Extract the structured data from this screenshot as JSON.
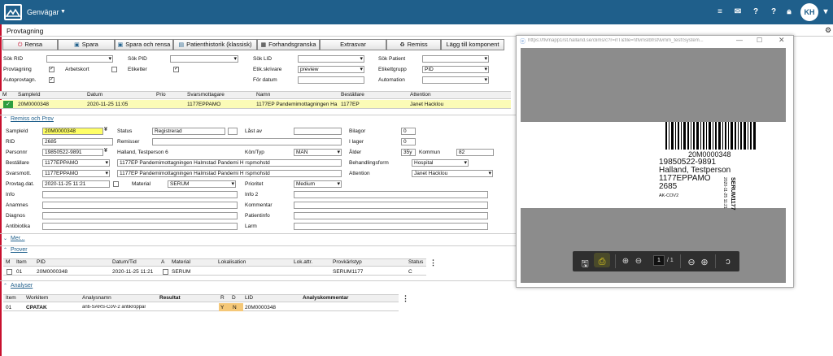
{
  "topbar": {
    "title": "Genvägar",
    "avatar": "KH",
    "icons": [
      "menu-icon",
      "mail-icon",
      "help-icon",
      "help-icon",
      "lock-icon"
    ]
  },
  "page": {
    "title": "Provtagning"
  },
  "toolbar": {
    "rensa": "Rensa",
    "spara": "Spara",
    "spara_rensa": "Spara och rensa",
    "historik": "Patienthistorik (klassisk)",
    "forhand": "Forhandsgranska",
    "extrasvar": "Extrasvar",
    "remiss": "Remiss",
    "lagg": "Lägg till komponent"
  },
  "search": {
    "sok_rid": "Sök RID",
    "sok_pid": "Sök PID",
    "sok_lid": "Sök LID",
    "sok_patient": "Sök Patient",
    "provtagning": "Provtagning",
    "arbetskort": "Arbetskort",
    "etiketter": "Etiketter",
    "etik_skrivare": "Etik.skrivare",
    "etik_skrivare_val": "preview",
    "etikettgrupp": "Etikettgrupp",
    "etikettgrupp_val": "PID",
    "autoprovtagn": "Autoprovtagn.",
    "for_datum": "För datum",
    "automation": "Automation"
  },
  "sample_table": {
    "headers": [
      "M",
      "SampleId",
      "Datum",
      "Prio",
      "Svarsmottagare",
      "Namn",
      "Beställare",
      "Attention"
    ],
    "row": [
      "",
      "20M0000348",
      "2020-11-25 11:05",
      "",
      "1177EPPAMO",
      "1177EP Pandemimottagningen Ha",
      "1177EP",
      "Janet Hacklou"
    ]
  },
  "remiss": {
    "section": "Remiss och Prov",
    "sampleid_label": "SampleId",
    "sampleid": "20M0000348",
    "status_label": "Status",
    "status": "Registrerad",
    "last_av_label": "Låst av",
    "bilagor_label": "Bilagor",
    "bilagor": "0",
    "rid_label": "RID",
    "rid": "2685",
    "remisser_label": "Remisser",
    "i_lager_label": "I lager",
    "i_lager": "0",
    "personnr_label": "Personnr",
    "personnr": "19850522-9891",
    "patient": "Halland, Testperson 6",
    "kon_label": "Kön/Typ",
    "kon": "MAN",
    "alder_label": "Ålder",
    "alder": "35y",
    "kommun_label": "Kommun",
    "kommun": "82",
    "bestallare_label": "Beställare",
    "bestallare": "1177EPPAMO",
    "bestallare_namn": "1177EP Pandemimottagningen Halmstad Pandemi H rspmohstd",
    "behandling_label": "Behandlingsform",
    "behandling": "Hospital",
    "svarsmott_label": "Svarsmott.",
    "svarsmott": "1177EPPAMO",
    "svarsmott_namn": "1177EP Pandemimottagningen Halmstad Pandemi H rspmohstd",
    "attention_label": "Attention",
    "attention": "Janet Hacklou",
    "provtag_label": "Provtag.dat.",
    "provtag": "2020-11-25 11:21",
    "material_label": "Material",
    "material": "SERUM",
    "prioritet_label": "Prioritet",
    "prioritet": "Medium",
    "info_label": "Info",
    "info2_label": "Info 2",
    "anamnes_label": "Anamnes",
    "kommentar_label": "Kommentar",
    "diagnos_label": "Diagnos",
    "patientinfo_label": "Patientinfo",
    "antibiotika_label": "Antibiotika",
    "larm_label": "Larm"
  },
  "mer": "Mer...",
  "prover": {
    "section": "Prover",
    "headers": [
      "M",
      "Item",
      "PID",
      "Datum/Tid",
      "A",
      "Material",
      "Lokalisation",
      "Lok.attr.",
      "Provkärlstyp",
      "Status"
    ],
    "row": [
      "",
      "01",
      "20M0000348",
      "2020-11-25 11:21",
      "",
      "SERUM",
      "",
      "",
      "SERUM1177",
      "C"
    ]
  },
  "analyser": {
    "section": "Analyser",
    "headers": [
      "Item",
      "Workitem",
      "Analysnamn",
      "Resultat",
      "R",
      "D",
      "LID",
      "Analyskommentar"
    ],
    "row": [
      "01",
      "CPATAK",
      "anti-SARS-CoV-2 antikroppar",
      "",
      "Y",
      "N",
      "20M0000348",
      ""
    ]
  },
  "popup": {
    "url": "https://flvmapp1rst.halland.se/clims/c?r=rrT&file=\\\\flvmslbfrst\\lvmm_test\\System...",
    "label": {
      "code": "20M0000348",
      "pnr": "19850522-9891",
      "name": "Halland, Testperson",
      "orderer": "1177EPPAMO",
      "rid": "2685",
      "analysis": "AK-COV2",
      "side_title": "SERUM1177",
      "side_date": "2020-11-25 11:21"
    },
    "page_current": "1",
    "page_total": "/ 1"
  },
  "colors": {
    "topbar": "#1f5f8b",
    "highlight": "#ffff66",
    "row": "#fbfbb7",
    "accent": "#c8102e"
  }
}
